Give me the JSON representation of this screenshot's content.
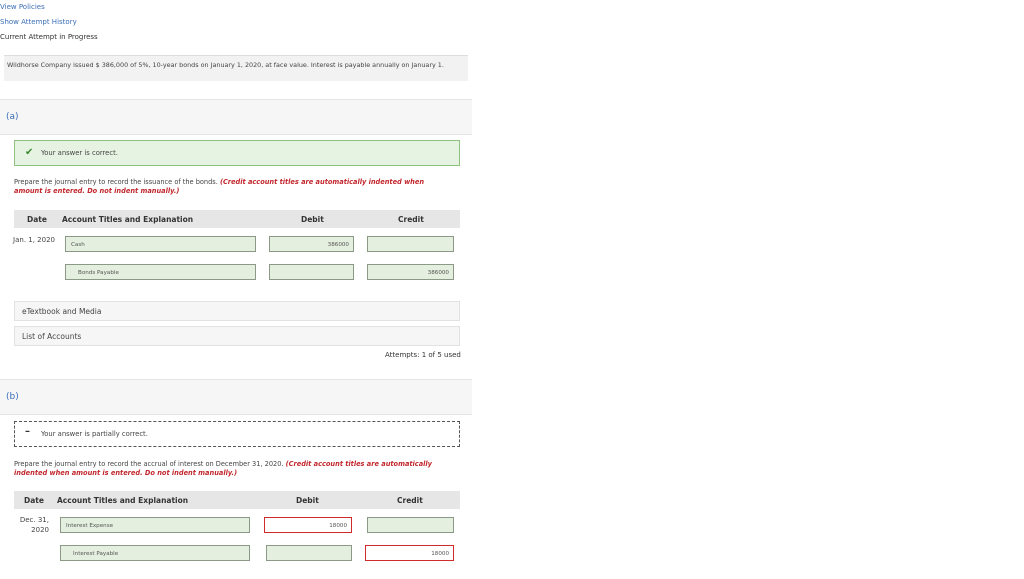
{
  "links": {
    "view_policies": "View Policies",
    "show_attempt_history": "Show Attempt History",
    "current_attempt": "Current Attempt in Progress"
  },
  "problem_text": "Wildhorse Company issued $ 386,000 of 5%, 10-year bonds on January 1, 2020, at face value. Interest is payable annually on January 1.",
  "part_a": {
    "label": "(a)",
    "feedback": "Your answer is correct.",
    "instruction": "Prepare the journal entry to record the issuance of the bonds.",
    "instruction_note": "(Credit account titles are automatically indented when amount is entered. Do not indent manually.)",
    "headers": {
      "date": "Date",
      "account": "Account Titles and Explanation",
      "debit": "Debit",
      "credit": "Credit"
    },
    "date": "Jan. 1, 2020",
    "rows": [
      {
        "account": "Cash",
        "debit": "386000",
        "credit": ""
      },
      {
        "account": "Bonds Payable",
        "debit": "",
        "credit": "386000"
      }
    ],
    "etextbook": "eTextbook and Media",
    "list_accounts": "List of Accounts",
    "attempts": "Attempts: 1 of 5 used"
  },
  "part_b": {
    "label": "(b)",
    "feedback": "Your answer is partially correct.",
    "instruction": "Prepare the journal entry to record the accrual of interest on December 31, 2020.",
    "instruction_note": "(Credit account titles are automatically indented when amount is entered. Do not indent manually.)",
    "headers": {
      "date": "Date",
      "account": "Account Titles and Explanation",
      "debit": "Debit",
      "credit": "Credit"
    },
    "date": "Dec. 31, 2020",
    "rows": [
      {
        "account": "Interest Expense",
        "debit": "18000",
        "credit": ""
      },
      {
        "account": "Interest Payable",
        "debit": "",
        "credit": "18000"
      }
    ]
  },
  "colors": {
    "link": "#3b6fb6",
    "correct_bg": "#e6f2e2",
    "error": "#d02a2a",
    "check": "#3a8a2e"
  }
}
